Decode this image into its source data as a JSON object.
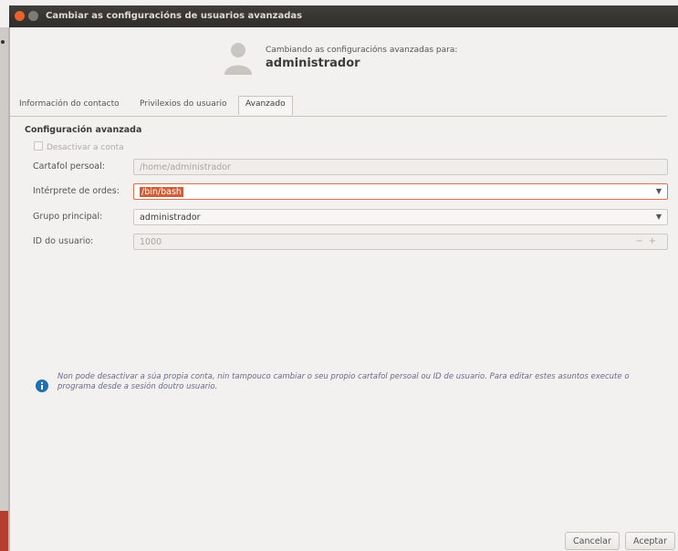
{
  "window": {
    "title": "Cambiar as configuracións de usuarios avanzadas"
  },
  "header": {
    "subtitle": "Cambiando as configuracións avanzadas para:",
    "username": "administrador",
    "avatar_icon": "user-avatar-icon"
  },
  "tabs": [
    {
      "label": "Información do contacto"
    },
    {
      "label": "Privilexios do usuario"
    },
    {
      "label": "Avanzado",
      "active": true
    }
  ],
  "advanced": {
    "section_title": "Configuración avanzada",
    "disable_account_label": "Desactivar a conta",
    "home_label": "Cartafol persoal:",
    "home_value": "/home/administrador",
    "shell_label": "Intérprete de ordes:",
    "shell_value": "/bin/bash",
    "group_label": "Grupo principal:",
    "group_value": "administrador",
    "uid_label": "ID do usuario:",
    "uid_value": "1000"
  },
  "info": {
    "icon": "info-icon",
    "text": "Non pode desactivar a súa propia conta, nin tampouco cambiar o seu propio cartafol persoal ou ID de usuario. Para editar estes asuntos execute o programa desde a sesión doutro usuario."
  },
  "buttons": {
    "cancel": "Cancelar",
    "accept": "Aceptar"
  },
  "colors": {
    "titlebar": "#3a3935",
    "accent": "#d05f39",
    "close": "#e9612e",
    "info": "#1f6fb5"
  }
}
